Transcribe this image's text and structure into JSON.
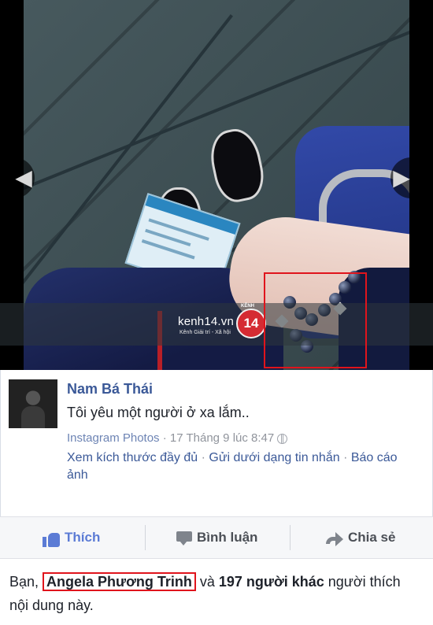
{
  "photo": {
    "watermark": {
      "brand": "kenh14.vn",
      "tagline": "Kênh Giải trí - Xã hội",
      "logo_mark": "14",
      "logo_label": "KÊNH"
    },
    "nav": {
      "prev_glyph": "◀",
      "next_glyph": "▶"
    }
  },
  "post": {
    "author": "Nam Bá Thái",
    "message": "Tôi yêu một người ở xa lắm..",
    "source": "Instagram Photos",
    "separator": " · ",
    "timestamp": "17 Tháng 9 lúc 8:47",
    "links": {
      "view_full": "Xem kích thước đầy đủ",
      "send_message": "Gửi dưới dạng tin nhắn",
      "report": "Báo cáo ảnh"
    }
  },
  "actions": {
    "like": "Thích",
    "comment": "Bình luận",
    "share": "Chia sẻ"
  },
  "likes": {
    "prefix": "Bạn, ",
    "friend": "Angela Phương Trinh",
    "middle": " và ",
    "others": "197 người khác",
    "suffix": " người thích nội dung này."
  },
  "colors": {
    "accent": "#3b5998",
    "like_blue": "#5b7bd5",
    "highlight": "#e0141c"
  }
}
